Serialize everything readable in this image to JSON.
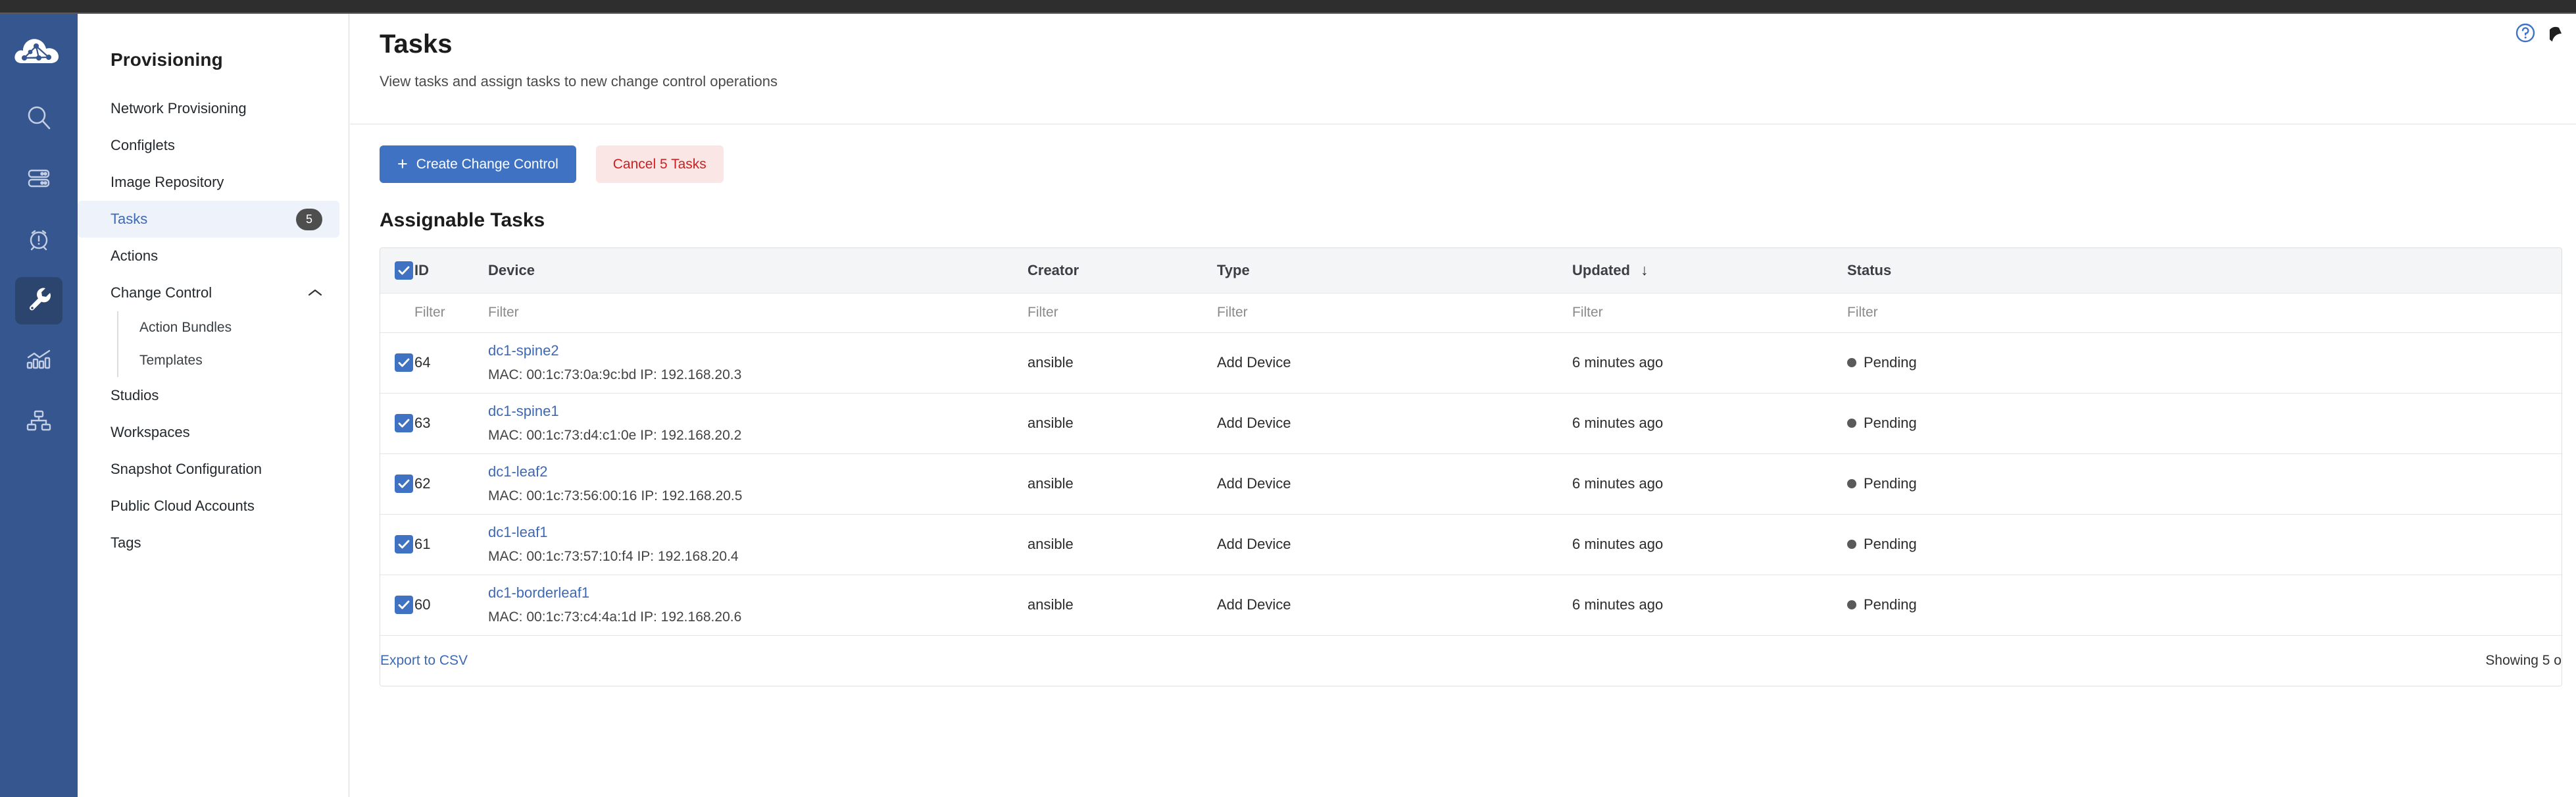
{
  "rail": {
    "icons": [
      {
        "name": "cloudvision-logo-icon",
        "active": false
      },
      {
        "name": "search-icon",
        "active": false
      },
      {
        "name": "devices-icon",
        "active": false
      },
      {
        "name": "events-alarm-icon",
        "active": false
      },
      {
        "name": "provisioning-wrench-icon",
        "active": true
      },
      {
        "name": "metrics-chart-icon",
        "active": false
      },
      {
        "name": "topology-icon",
        "active": false
      }
    ]
  },
  "sidebar": {
    "title": "Provisioning",
    "items": [
      {
        "label": "Network Provisioning",
        "badge": null,
        "selected": false,
        "expandable": false
      },
      {
        "label": "Configlets",
        "badge": null,
        "selected": false,
        "expandable": false
      },
      {
        "label": "Image Repository",
        "badge": null,
        "selected": false,
        "expandable": false
      },
      {
        "label": "Tasks",
        "badge": "5",
        "selected": true,
        "expandable": false
      },
      {
        "label": "Actions",
        "badge": null,
        "selected": false,
        "expandable": false
      },
      {
        "label": "Change Control",
        "badge": null,
        "selected": false,
        "expandable": true,
        "expanded": true,
        "children": [
          {
            "label": "Action Bundles"
          },
          {
            "label": "Templates"
          }
        ]
      },
      {
        "label": "Studios",
        "badge": null,
        "selected": false,
        "expandable": false
      },
      {
        "label": "Workspaces",
        "badge": null,
        "selected": false,
        "expandable": false
      },
      {
        "label": "Snapshot Configuration",
        "badge": null,
        "selected": false,
        "expandable": false
      },
      {
        "label": "Public Cloud Accounts",
        "badge": null,
        "selected": false,
        "expandable": false
      },
      {
        "label": "Tags",
        "badge": null,
        "selected": false,
        "expandable": false
      }
    ]
  },
  "header": {
    "title": "Tasks",
    "subtitle": "View tasks and assign tasks to new change control operations",
    "help_icon": "help-circle-icon",
    "user_icon": "user-avatar-icon"
  },
  "toolbar": {
    "create_label": "Create Change Control",
    "create_plus": "+",
    "cancel_label": "Cancel 5 Tasks"
  },
  "table": {
    "section_title": "Assignable Tasks",
    "header_all_checked": true,
    "columns": [
      {
        "key": "id",
        "label": "ID",
        "sorted": false
      },
      {
        "key": "device",
        "label": "Device",
        "sorted": false
      },
      {
        "key": "creator",
        "label": "Creator",
        "sorted": false
      },
      {
        "key": "type",
        "label": "Type",
        "sorted": false
      },
      {
        "key": "updated",
        "label": "Updated",
        "sorted": true,
        "sort_arrow": "↓"
      },
      {
        "key": "status",
        "label": "Status",
        "sorted": false
      }
    ],
    "filter_placeholder": "Filter",
    "rows": [
      {
        "checked": true,
        "id": "64",
        "device": "dc1-spine2",
        "meta": "MAC: 00:1c:73:0a:9c:bd IP: 192.168.20.3",
        "creator": "ansible",
        "type": "Add Device",
        "updated": "6 minutes ago",
        "status": "Pending"
      },
      {
        "checked": true,
        "id": "63",
        "device": "dc1-spine1",
        "meta": "MAC: 00:1c:73:d4:c1:0e IP: 192.168.20.2",
        "creator": "ansible",
        "type": "Add Device",
        "updated": "6 minutes ago",
        "status": "Pending"
      },
      {
        "checked": true,
        "id": "62",
        "device": "dc1-leaf2",
        "meta": "MAC: 00:1c:73:56:00:16 IP: 192.168.20.5",
        "creator": "ansible",
        "type": "Add Device",
        "updated": "6 minutes ago",
        "status": "Pending"
      },
      {
        "checked": true,
        "id": "61",
        "device": "dc1-leaf1",
        "meta": "MAC: 00:1c:73:57:10:f4 IP: 192.168.20.4",
        "creator": "ansible",
        "type": "Add Device",
        "updated": "6 minutes ago",
        "status": "Pending"
      },
      {
        "checked": true,
        "id": "60",
        "device": "dc1-borderleaf1",
        "meta": "MAC: 00:1c:73:c4:4a:1d IP: 192.168.20.6",
        "creator": "ansible",
        "type": "Add Device",
        "updated": "6 minutes ago",
        "status": "Pending"
      }
    ],
    "footer": {
      "export_label": "Export to CSV",
      "showing_label": "Showing 5 o"
    }
  },
  "colors": {
    "rail_bg": "#35568f",
    "rail_active": "#2b456f",
    "primary": "#4072c4",
    "danger_text": "#cc2020",
    "danger_bg": "#fbe6e6",
    "link": "#3e69b5",
    "status_dot": "#5a5a5a",
    "selected_nav_bg": "#eef2fb"
  }
}
